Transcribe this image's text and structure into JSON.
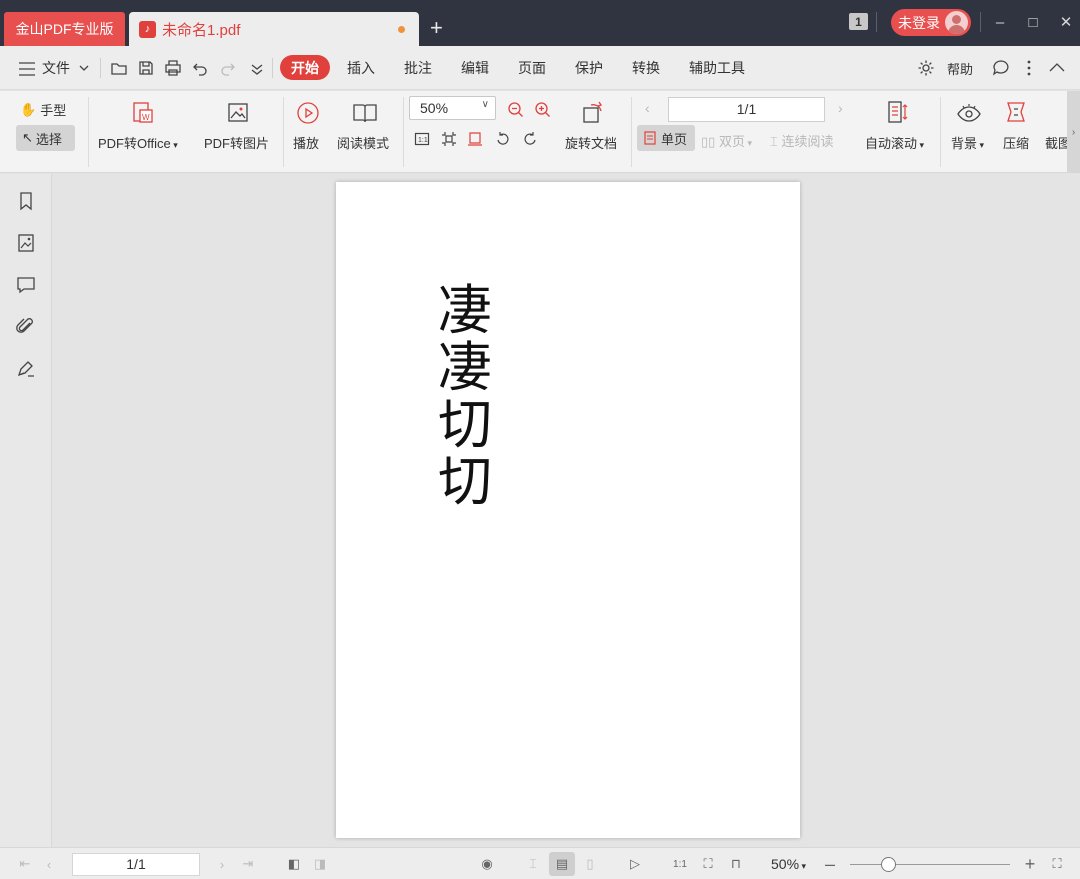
{
  "titlebar": {
    "brand_tab": "金山PDF专业版",
    "doc_tab": "未命名1.pdf",
    "window_count": "1",
    "login": "未登录"
  },
  "menubar": {
    "file": "文件",
    "tabs": [
      "开始",
      "插入",
      "批注",
      "编辑",
      "页面",
      "保护",
      "转换",
      "辅助工具"
    ],
    "help": "帮助"
  },
  "ribbon": {
    "hand_tool": "手型",
    "select_tool": "选择",
    "pdf_to_office": "PDF转Office",
    "pdf_to_image": "PDF转图片",
    "play": "播放",
    "read_mode": "阅读模式",
    "zoom": "50%",
    "rotate_doc": "旋转文档",
    "page_indicator": "1/1",
    "single_page": "单页",
    "double_page": "双页",
    "continuous_read": "连续阅读",
    "auto_scroll": "自动滚动",
    "background": "背景",
    "compress": "压缩",
    "screenshot": "截图"
  },
  "document": {
    "vertical_text": [
      "凄",
      "凄",
      "切",
      "切"
    ]
  },
  "statusbar": {
    "page": "1/1",
    "zoom": "50%"
  }
}
